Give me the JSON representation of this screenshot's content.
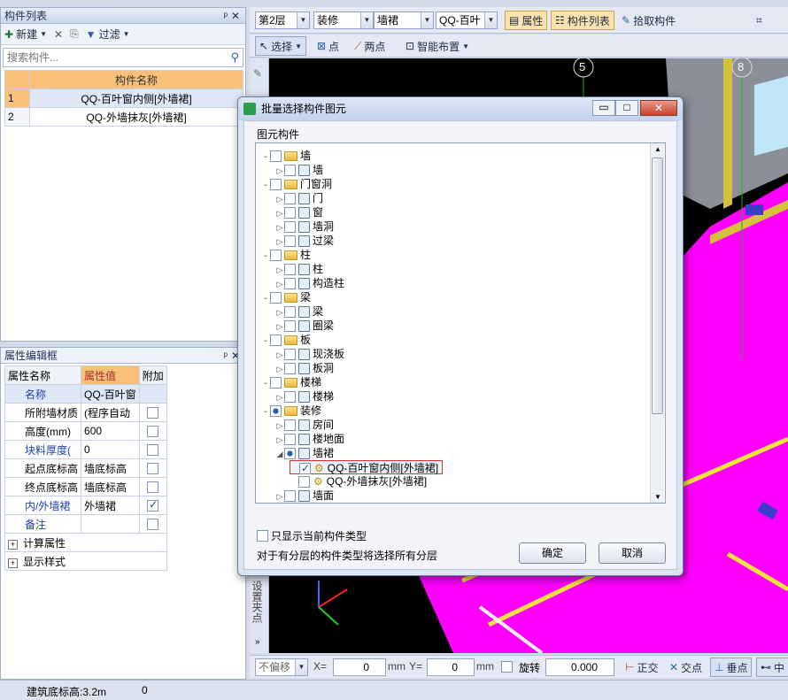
{
  "left_panel": {
    "title": "构件列表",
    "new_label": "新建",
    "filter_label": "过滤",
    "search_placeholder": "搜索构件...",
    "column_header": "构件名称",
    "rows": [
      {
        "num": "1",
        "name": "QQ-百叶窗内侧[外墙裙]"
      },
      {
        "num": "2",
        "name": "QQ-外墙抹灰[外墙裙]"
      }
    ]
  },
  "props": {
    "title": "属性编辑框",
    "headers": [
      "属性名称",
      "属性值",
      "附加"
    ],
    "rows": [
      {
        "name": "名称",
        "value": "QQ-百叶窗",
        "attach": null,
        "blue": true
      },
      {
        "name": "所附墙材质",
        "value": "(程序自动",
        "attach": false,
        "blue": false
      },
      {
        "name": "高度(mm)",
        "value": "600",
        "attach": false,
        "blue": false
      },
      {
        "name": "块料厚度(",
        "value": "0",
        "attach": false,
        "blue": true
      },
      {
        "name": "起点底标高",
        "value": "墙底标高",
        "attach": false,
        "blue": false
      },
      {
        "name": "终点底标高",
        "value": "墙底标高",
        "attach": false,
        "blue": false
      },
      {
        "name": "内/外墙裙",
        "value": "外墙裙",
        "attach": true,
        "blue": true
      },
      {
        "name": "备注",
        "value": "",
        "attach": false,
        "blue": true
      }
    ],
    "groups": [
      "计算属性",
      "显示样式"
    ]
  },
  "toolbar": {
    "floor": "第2层",
    "category": "装修",
    "type": "墙裙",
    "item": "QQ-百叶",
    "attr_label": "属性",
    "list_label": "构件列表",
    "pick_label": "拾取构件",
    "select_label": "选择",
    "point_label": "点",
    "twopoint_label": "两点",
    "smart_label": "智能布置"
  },
  "dialog": {
    "title": "批量选择构件图元",
    "group_label": "图元构件",
    "tree": [
      {
        "t": "墙",
        "l": 0,
        "kind": "folder",
        "exp": "−"
      },
      {
        "t": "墙",
        "l": 1,
        "kind": "item",
        "exp": "▷"
      },
      {
        "t": "门窗洞",
        "l": 0,
        "kind": "folder",
        "exp": "−"
      },
      {
        "t": "门",
        "l": 1,
        "kind": "item",
        "exp": "▷"
      },
      {
        "t": "窗",
        "l": 1,
        "kind": "item",
        "exp": "▷"
      },
      {
        "t": "墙洞",
        "l": 1,
        "kind": "item",
        "exp": "▷"
      },
      {
        "t": "过梁",
        "l": 1,
        "kind": "item",
        "exp": "▷"
      },
      {
        "t": "柱",
        "l": 0,
        "kind": "folder",
        "exp": "−"
      },
      {
        "t": "柱",
        "l": 1,
        "kind": "item",
        "exp": "▷"
      },
      {
        "t": "构造柱",
        "l": 1,
        "kind": "item",
        "exp": "▷"
      },
      {
        "t": "梁",
        "l": 0,
        "kind": "folder",
        "exp": "−"
      },
      {
        "t": "梁",
        "l": 1,
        "kind": "item",
        "exp": "▷"
      },
      {
        "t": "圈梁",
        "l": 1,
        "kind": "item",
        "exp": "▷"
      },
      {
        "t": "板",
        "l": 0,
        "kind": "folder",
        "exp": "−"
      },
      {
        "t": "现浇板",
        "l": 1,
        "kind": "item",
        "exp": "▷"
      },
      {
        "t": "板洞",
        "l": 1,
        "kind": "item",
        "exp": "▷"
      },
      {
        "t": "楼梯",
        "l": 0,
        "kind": "folder",
        "exp": "−"
      },
      {
        "t": "楼梯",
        "l": 1,
        "kind": "item",
        "exp": "▷"
      },
      {
        "t": "装修",
        "l": 0,
        "kind": "folder",
        "exp": "−",
        "partial": true
      },
      {
        "t": "房间",
        "l": 1,
        "kind": "item",
        "exp": "▷"
      },
      {
        "t": "楼地面",
        "l": 1,
        "kind": "item",
        "exp": "▷"
      },
      {
        "t": "墙裙",
        "l": 1,
        "kind": "item",
        "exp": "◢",
        "partial": true
      },
      {
        "t": "QQ-百叶窗内侧[外墙裙]",
        "l": 2,
        "kind": "leaf",
        "checked": true,
        "highlight": true
      },
      {
        "t": "QQ-外墙抹灰[外墙裙]",
        "l": 2,
        "kind": "leaf"
      },
      {
        "t": "墙面",
        "l": 1,
        "kind": "item",
        "exp": "▷"
      }
    ],
    "only_current_label": "只显示当前构件类型",
    "note": "对于有分层的构件类型将选择所有分层",
    "ok_label": "确定",
    "cancel_label": "取消"
  },
  "viewport": {
    "axis_labels": [
      "5",
      "8"
    ],
    "side_label": "设置夹点"
  },
  "statusbar": {
    "offset_label": "不偏移",
    "x_label": "X=",
    "x_value": "0",
    "mm1": "mm",
    "y_label": "Y=",
    "y_value": "0",
    "mm2": "mm",
    "rotate_label": "旋转",
    "rotate_value": "0.000",
    "ortho_label": "正交",
    "cross_label": "交点",
    "perp_label": "垂点",
    "mid_label": "中",
    "left_status": "建筑底标高:3.2m",
    "left_status2": "0"
  },
  "colors": {
    "accent": "#2b5fad",
    "magenta": "#ff00ff",
    "header": "#f9c07a"
  }
}
